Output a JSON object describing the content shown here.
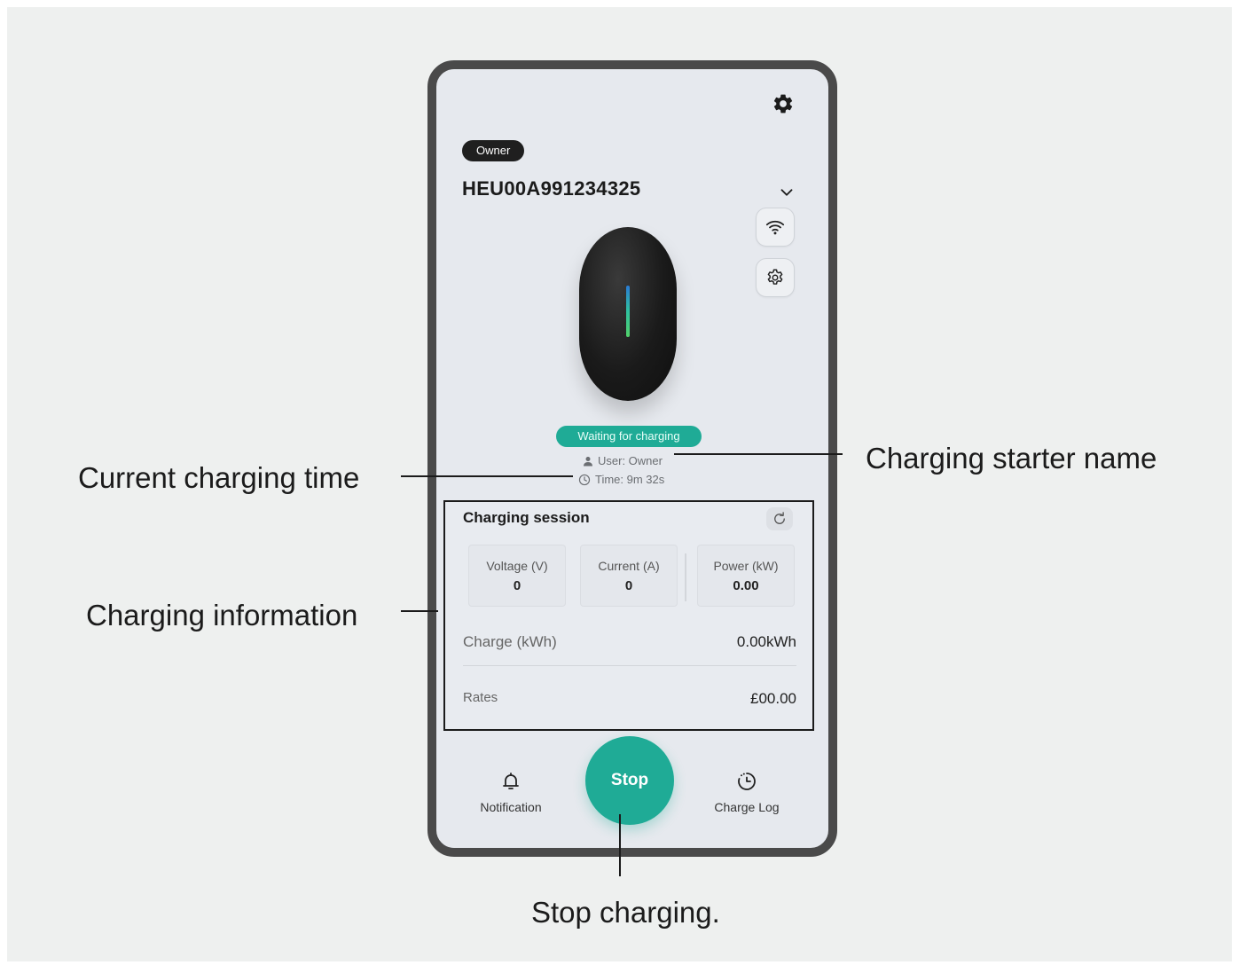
{
  "app": {
    "role_badge": "Owner",
    "device_id": "HEU00A991234325",
    "status": "Waiting for charging",
    "user_line": "User: Owner",
    "time_line": "Time: 9m 32s"
  },
  "session": {
    "title": "Charging session",
    "metrics": [
      {
        "label": "Voltage (V)",
        "value": "0"
      },
      {
        "label": "Current (A)",
        "value": "0"
      },
      {
        "label": "Power (kW)",
        "value": "0.00"
      }
    ],
    "charge": {
      "label": "Charge (kWh)",
      "value": "0.00kWh"
    },
    "rates": {
      "label": "Rates",
      "value": "£00.00"
    }
  },
  "nav": {
    "notification": "Notification",
    "stop": "Stop",
    "charge_log": "Charge Log"
  },
  "callouts": {
    "time": "Current charging time",
    "info": "Charging information",
    "starter": "Charging starter name",
    "stop": "Stop charging."
  },
  "icons": [
    "gear-icon",
    "chevron-down-icon",
    "wifi-icon",
    "settings-icon",
    "user-icon",
    "clock-icon",
    "refresh-icon",
    "bell-icon",
    "history-icon"
  ],
  "colors": {
    "accent": "#1fab96",
    "frame": "#4a4a4a",
    "background": "#eef0ef"
  }
}
